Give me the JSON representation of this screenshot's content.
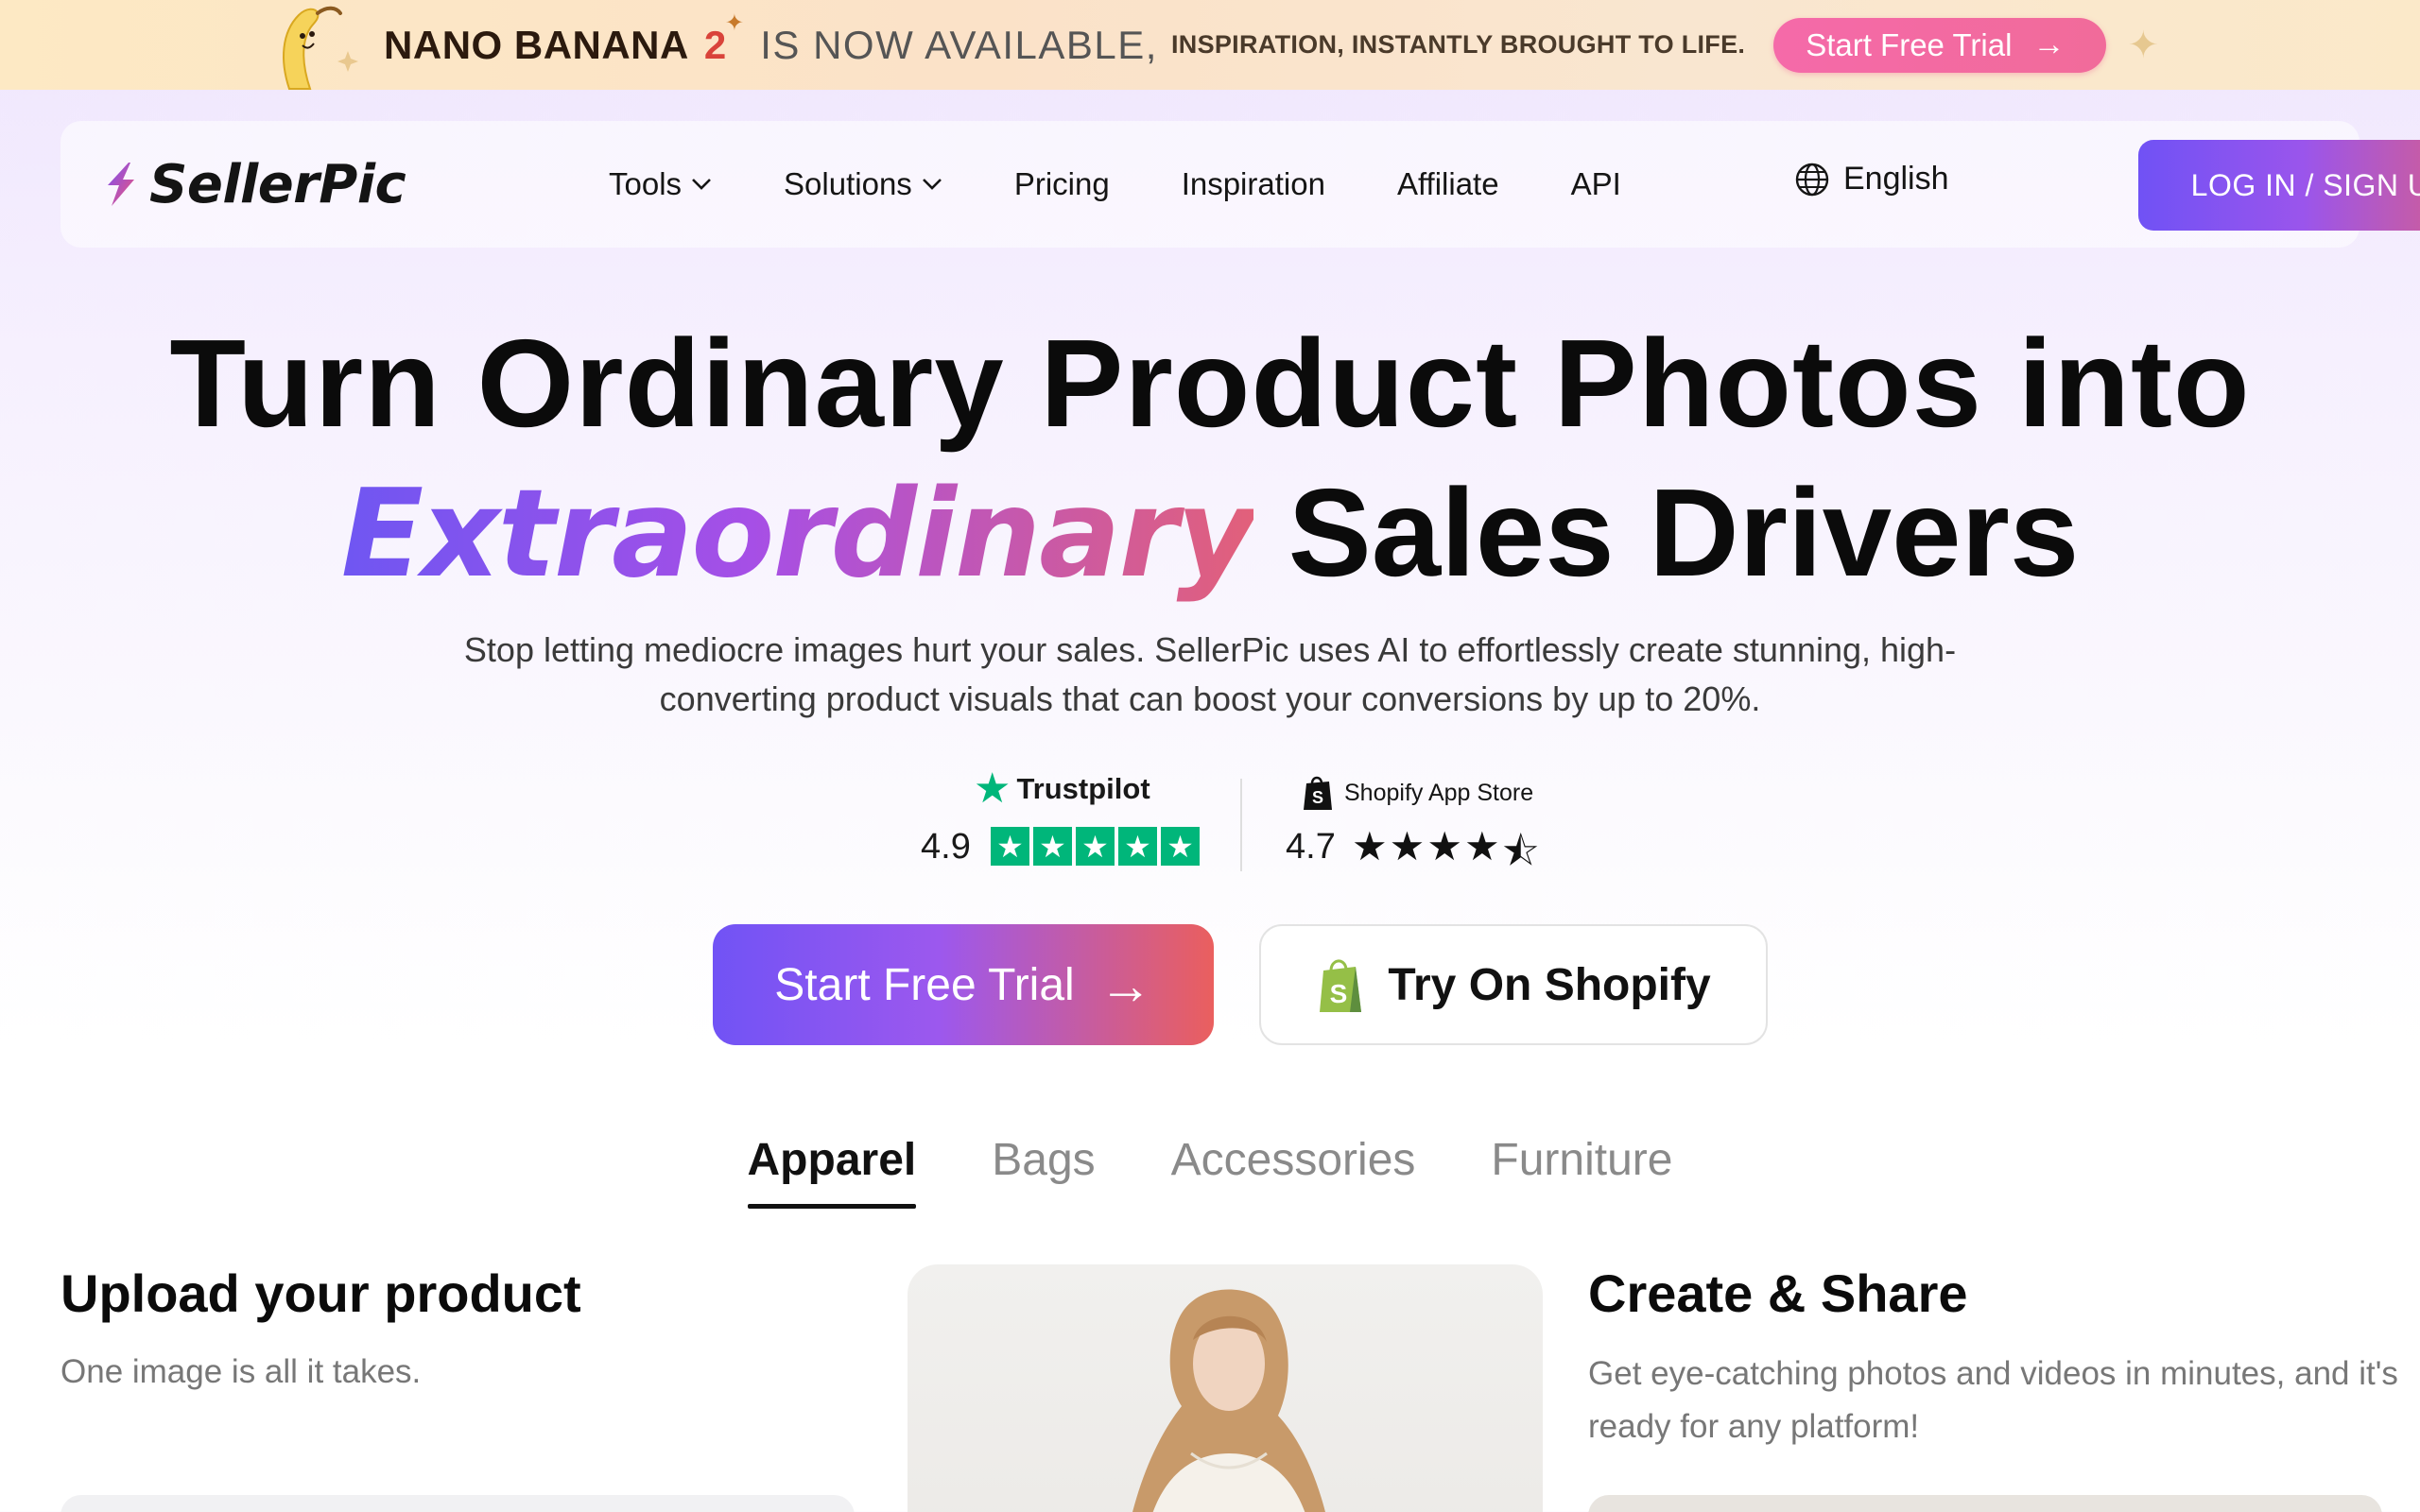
{
  "promo": {
    "title": "NANO BANANA",
    "version": "2",
    "available": "IS NOW AVAILABLE,",
    "tagline": "INSPIRATION, INSTANTLY BROUGHT TO LIFE.",
    "cta_label": "Start Free Trial"
  },
  "nav": {
    "logo_text": "SellerPic",
    "links": [
      {
        "label": "Tools",
        "has_dropdown": true
      },
      {
        "label": "Solutions",
        "has_dropdown": true
      },
      {
        "label": "Pricing"
      },
      {
        "label": "Inspiration"
      },
      {
        "label": "Affiliate"
      },
      {
        "label": "API"
      }
    ],
    "language": "English",
    "login_label": "LOG IN / SIGN UP"
  },
  "hero": {
    "line1": "Turn Ordinary Product Photos into",
    "highlight": "Extraordinary",
    "line2_rest": "Sales Drivers",
    "subtitle": "Stop letting mediocre images hurt your sales. SellerPic uses AI to effortlessly create stunning, high-converting product visuals that can boost your conversions by up to 20%."
  },
  "ratings": {
    "trustpilot": {
      "name": "Trustpilot",
      "score": "4.9",
      "stars": 5
    },
    "shopify": {
      "name": "Shopify App Store",
      "score": "4.7",
      "stars": 4.5
    }
  },
  "cta": {
    "primary_label": "Start Free Trial",
    "secondary_label": "Try On Shopify"
  },
  "tabs": [
    {
      "label": "Apparel",
      "active": true
    },
    {
      "label": "Bags",
      "active": false
    },
    {
      "label": "Accessories",
      "active": false
    },
    {
      "label": "Furniture",
      "active": false
    }
  ],
  "steps": {
    "upload_title": "Upload your product",
    "upload_sub": "One image is all it takes.",
    "create_title": "Create & Share",
    "create_sub": "Get eye-catching photos and videos in minutes, and it's ready for any platform!"
  },
  "colors": {
    "brand_gradient_start": "#7052f5",
    "brand_gradient_end": "#e2607a",
    "trustpilot_green": "#00b67a",
    "promo_pink": "#f56aa9"
  }
}
